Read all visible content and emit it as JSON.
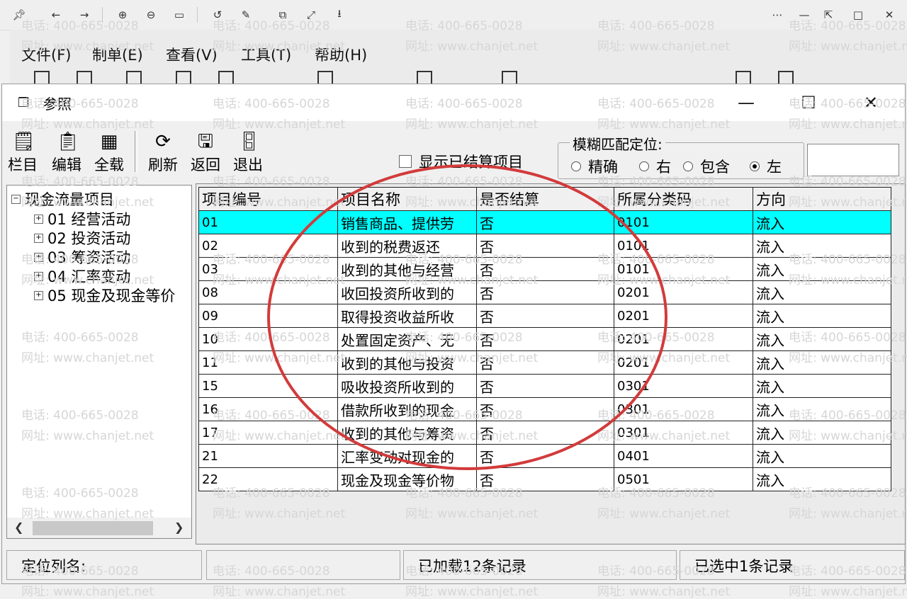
{
  "menu": [
    "文件(F)",
    "制单(E)",
    "查看(V)",
    "工具(T)",
    "帮助(H)"
  ],
  "dialog": {
    "title": "参照"
  },
  "toolbar": [
    {
      "label": "栏目",
      "icon": "columns-icon"
    },
    {
      "label": "编辑",
      "icon": "edit-icon"
    },
    {
      "label": "全载",
      "icon": "load-all-icon"
    },
    {
      "label": "刷新",
      "icon": "refresh-icon"
    },
    {
      "label": "返回",
      "icon": "return-icon"
    },
    {
      "label": "退出",
      "icon": "exit-icon"
    }
  ],
  "show_settled": "显示已结算项目",
  "fuzzy": {
    "legend": "模糊匹配定位:",
    "options": [
      {
        "label": "精确",
        "selected": false
      },
      {
        "label": "右",
        "selected": false
      },
      {
        "label": "包含",
        "selected": false
      },
      {
        "label": "左",
        "selected": true
      }
    ]
  },
  "tree": {
    "root": "现金流量项目",
    "nodes": [
      "01 经营活动",
      "02 投资活动",
      "03 筹资活动",
      "04 汇率变动",
      "05 现金及现金等价"
    ]
  },
  "grid": {
    "headers": [
      "项目编号",
      "项目名称",
      "是否结算",
      "所属分类码",
      "方向"
    ],
    "rows": [
      [
        "01",
        "销售商品、提供劳",
        "否",
        "0101",
        "流入"
      ],
      [
        "02",
        "收到的税费返还",
        "否",
        "0101",
        "流入"
      ],
      [
        "03",
        "收到的其他与经营",
        "否",
        "0101",
        "流入"
      ],
      [
        "08",
        "收回投资所收到的",
        "否",
        "0201",
        "流入"
      ],
      [
        "09",
        "取得投资收益所收",
        "否",
        "0201",
        "流入"
      ],
      [
        "10",
        "处置固定资产、无",
        "否",
        "0201",
        "流入"
      ],
      [
        "11",
        "收到的其他与投资",
        "否",
        "0201",
        "流入"
      ],
      [
        "15",
        "吸收投资所收到的",
        "否",
        "0301",
        "流入"
      ],
      [
        "16",
        "借款所收到的现金",
        "否",
        "0301",
        "流入"
      ],
      [
        "17",
        "收到的其他与筹资",
        "否",
        "0301",
        "流入"
      ],
      [
        "21",
        "汇率变动对现金的",
        "否",
        "0401",
        "流入"
      ],
      [
        "22",
        "现金及现金等价物",
        "否",
        "0501",
        "流入"
      ]
    ]
  },
  "status": {
    "locate_label": "定位列名:",
    "loaded": "已加载12条记录",
    "selected": "已选中1条记录"
  },
  "watermark": {
    "phone": "电话: 400-665-0028",
    "site": "网址: www.chanjet.net"
  }
}
